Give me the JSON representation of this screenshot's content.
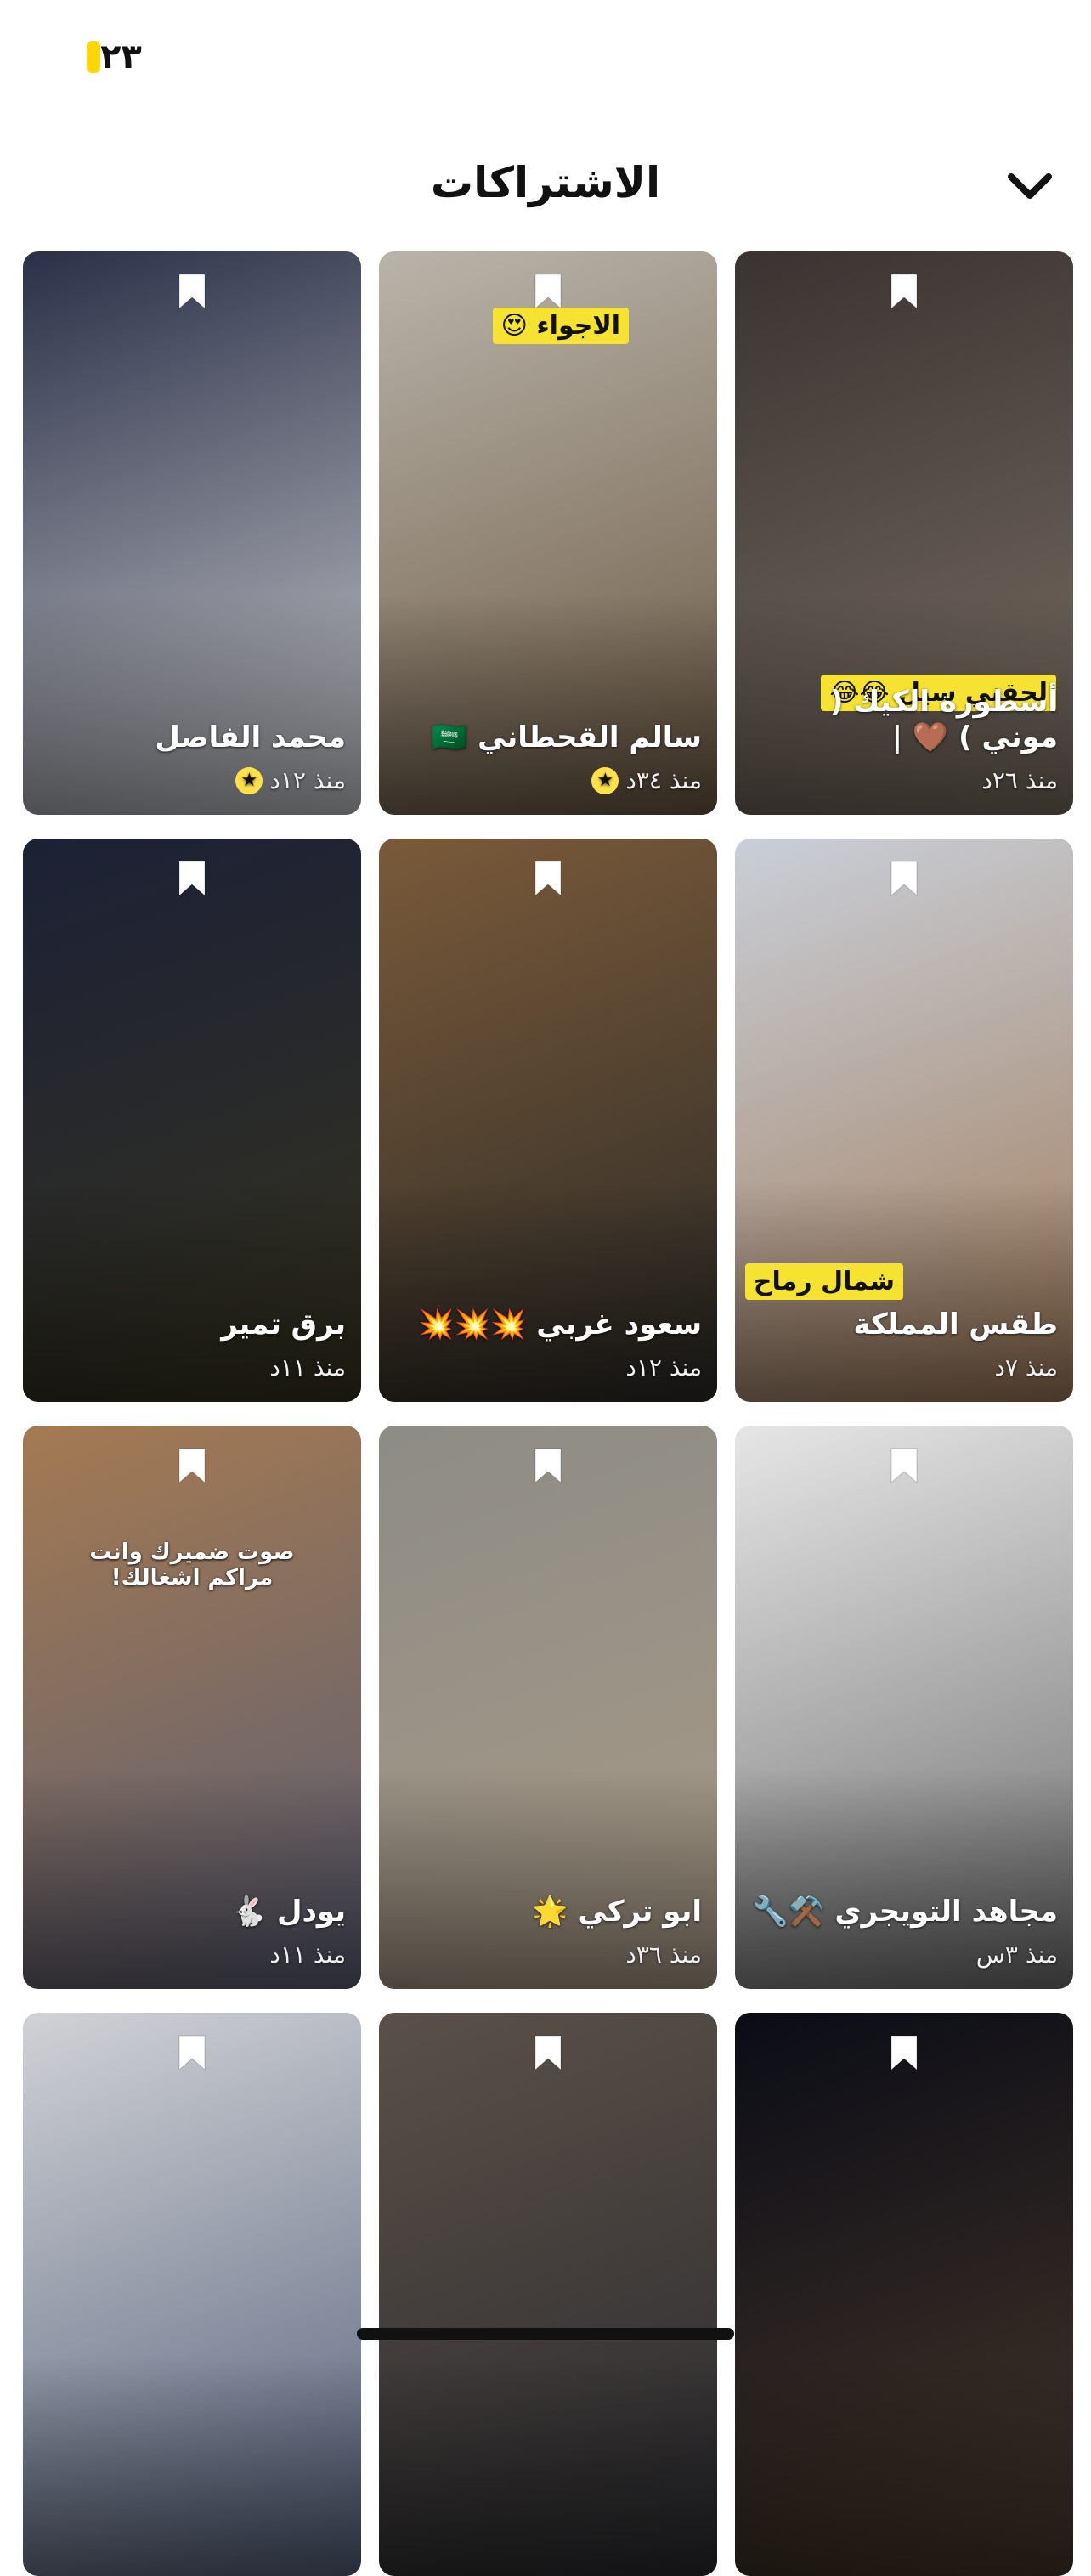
{
  "status": {
    "counter": "٢٣"
  },
  "header": {
    "title": "الاشتراكات"
  },
  "tiles": [
    {
      "name": "أسطورة الكيك ( موني ) 🤎 |",
      "time": "منذ ٢٦د",
      "caption": "لحقني سيل 😂😂",
      "has_star": false,
      "bg": [
        "#3a3331",
        "#7a6e63"
      ]
    },
    {
      "name": "سالم القحطاني 🇸🇦",
      "time": "منذ ٣٤د",
      "caption": "الاجواء 😍",
      "has_star": true,
      "bg": [
        "#b9b4aa",
        "#6b5842"
      ]
    },
    {
      "name": "محمد الفاصل",
      "time": "منذ ١٢د",
      "caption": "",
      "has_star": true,
      "bg": [
        "#2b3048",
        "#c7c8cc"
      ]
    },
    {
      "name": "طقس المملكة",
      "time": "منذ ٧د",
      "caption": "شمال رماح",
      "has_star": false,
      "bg": [
        "#c9cfd8",
        "#a07b5b"
      ]
    },
    {
      "name": "سعود غربي 💥💥💥",
      "time": "منذ ١٢د",
      "caption": "",
      "has_star": false,
      "bg": [
        "#7a5a3a",
        "#2b2a26"
      ]
    },
    {
      "name": "برق تمير",
      "time": "منذ ١١د",
      "caption": "",
      "has_star": false,
      "bg": [
        "#1c2136",
        "#35321f"
      ]
    },
    {
      "name": "مجاهد التويجري ⚒️🔧",
      "time": "منذ ٣س",
      "caption": "",
      "has_star": false,
      "bg": [
        "#e6e6e6",
        "#6f6f70"
      ]
    },
    {
      "name": "ابو تركي 🌟",
      "time": "منذ ٣٦د",
      "caption": "",
      "has_star": false,
      "bg": [
        "#8d8c86",
        "#a99a86"
      ]
    },
    {
      "name": "يودل 🐇",
      "time": "منذ ١١د",
      "caption": "صوت ضميرك وانت مراكم اشغالك!",
      "has_star": false,
      "bg": [
        "#a47a52",
        "#5b5e73"
      ]
    },
    {
      "name": "",
      "time": "",
      "caption": "",
      "has_star": false,
      "bg": [
        "#0a0c16",
        "#47372a"
      ]
    },
    {
      "name": "",
      "time": "",
      "caption": "",
      "has_star": false,
      "bg": [
        "#5a5048",
        "#2a2a2e"
      ]
    },
    {
      "name": "",
      "time": "",
      "caption": "",
      "has_star": false,
      "bg": [
        "#d0d2d6",
        "#56607a"
      ]
    }
  ]
}
